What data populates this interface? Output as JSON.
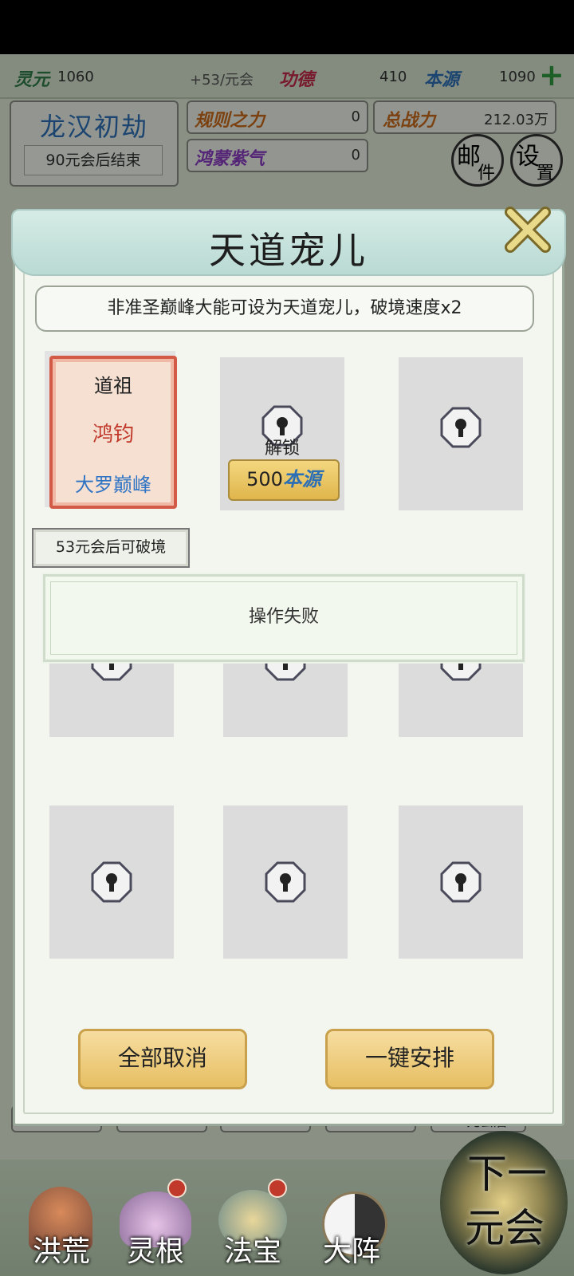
{
  "status_bar": {
    "lingyuan_label": "灵元",
    "lingyuan_value": "1060",
    "lingyuan_rate": "+53/元会",
    "gongde_label": "功德",
    "gongde_value": "410",
    "benyuan_label": "本源",
    "benyuan_value": "1090",
    "plus_icon": "plus-icon"
  },
  "era": {
    "title": "龙汉初劫",
    "subtitle": "90元会后结束"
  },
  "stats": {
    "guize_label": "规则之力",
    "guize_value": "0",
    "zongzhanli_label": "总战力",
    "zongzhanli_value": "212.03万",
    "hongmeng_label": "鸿蒙紫气",
    "hongmeng_value": "0"
  },
  "top_buttons": {
    "mail": [
      "邮",
      "件"
    ],
    "settings": [
      "设",
      "置"
    ]
  },
  "modal": {
    "title": "天道宠儿",
    "description": "非准圣巅峰大能可设为天道宠儿，破境速度x2",
    "card": {
      "rank": "道祖",
      "name": "鸿钧",
      "realm": "大罗巅峰"
    },
    "unlock_label": "解锁",
    "unlock_cost": "500",
    "unlock_currency": "本源",
    "breakthrough_tag": "53元会后可破境",
    "cancel_all": "全部取消",
    "auto_arrange": "一键安排"
  },
  "toast": {
    "message": "操作失败"
  },
  "bottom_partial": {
    "tag": "15元会后"
  },
  "nav": {
    "items": [
      "洪荒",
      "灵根",
      "法宝",
      "大阵"
    ],
    "next_line1": "下一",
    "next_line2": "元会"
  },
  "colors": {
    "gold_button": "#e7bf63",
    "card_border": "#d25a47",
    "name_red": "#c0392b",
    "realm_blue": "#2f74c4",
    "benyuan_blue": "#2c6fb5",
    "gongde_red": "#c12a4a"
  }
}
